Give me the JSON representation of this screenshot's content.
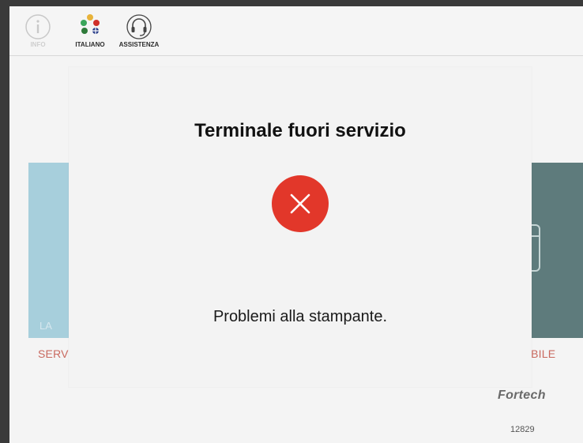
{
  "topbar": {
    "items": [
      {
        "label": "INFO",
        "icon": "info-icon"
      },
      {
        "label": "ITALIANO",
        "icon": "language-flags-icon"
      },
      {
        "label": "ASSISTENZA",
        "icon": "headset-icon"
      }
    ]
  },
  "background": {
    "left_tile_text": "LA",
    "left_service_label": "SERVI",
    "right_service_label": "IBILE",
    "brand": "Fortech",
    "terminal_id": "12829"
  },
  "dialog": {
    "title": "Terminale fuori servizio",
    "status_icon": "error-x-icon",
    "message": "Problemi alla stampante."
  },
  "colors": {
    "error": "#e2372a",
    "tile_light": "#a7cfdc",
    "tile_dark": "#5e7b7c",
    "service_label": "#c9695f"
  }
}
